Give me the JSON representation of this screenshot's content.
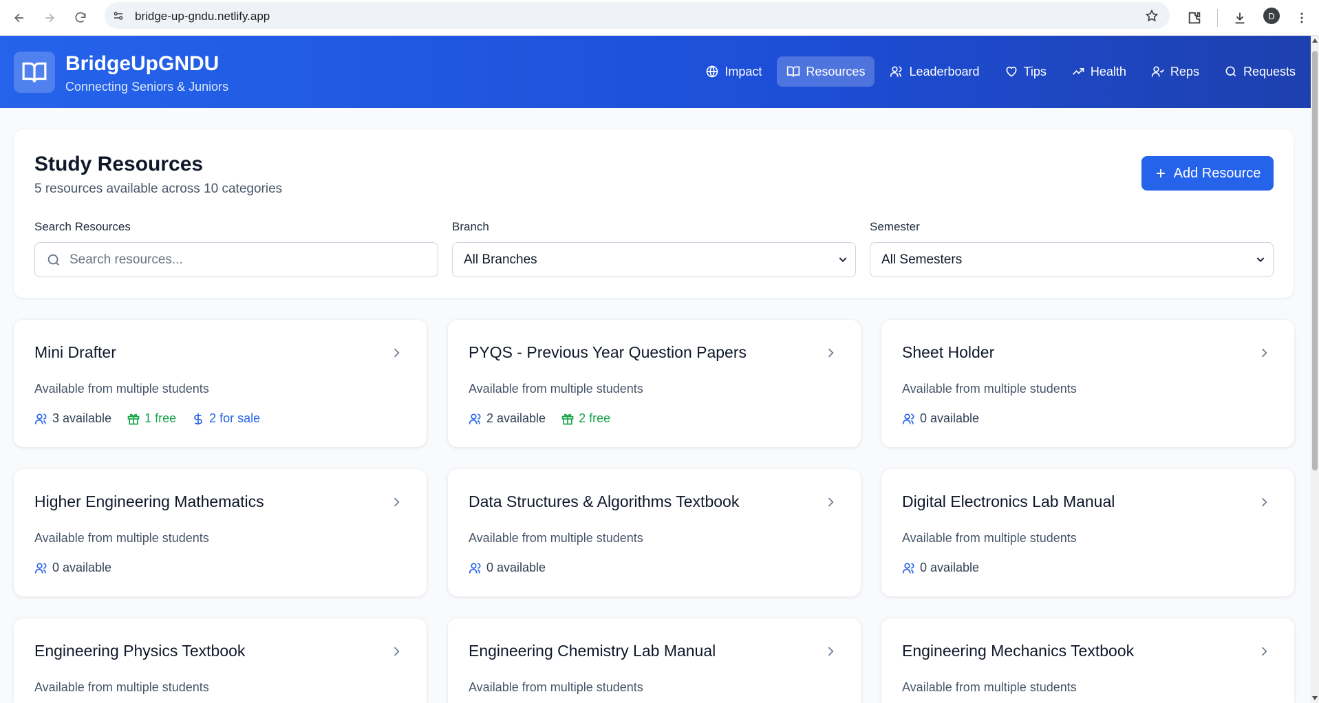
{
  "browser": {
    "url": "bridge-up-gndu.netlify.app",
    "profile_initial": "D"
  },
  "header": {
    "brand": "BridgeUpGNDU",
    "tagline": "Connecting Seniors & Juniors",
    "nav": [
      {
        "label": "Impact",
        "icon": "globe-icon"
      },
      {
        "label": "Resources",
        "icon": "book-open-icon",
        "active": true
      },
      {
        "label": "Leaderboard",
        "icon": "users-icon"
      },
      {
        "label": "Tips",
        "icon": "heart-icon"
      },
      {
        "label": "Health",
        "icon": "trending-up-icon"
      },
      {
        "label": "Reps",
        "icon": "user-check-icon"
      },
      {
        "label": "Requests",
        "icon": "search-icon"
      }
    ]
  },
  "panel": {
    "title": "Study Resources",
    "subtitle": "5 resources available across 10 categories",
    "add_label": "Add Resource",
    "search_label": "Search Resources",
    "search_placeholder": "Search resources...",
    "branch_label": "Branch",
    "branch_value": "All Branches",
    "semester_label": "Semester",
    "semester_value": "All Semesters"
  },
  "cards": [
    {
      "title": "Mini Drafter",
      "desc": "Available from multiple students",
      "available": "3 available",
      "free": "1 free",
      "sale": "2 for sale"
    },
    {
      "title": "PYQS - Previous Year Question Papers",
      "desc": "Available from multiple students",
      "available": "2 available",
      "free": "2 free"
    },
    {
      "title": "Sheet Holder",
      "desc": "Available from multiple students",
      "available": "0 available"
    },
    {
      "title": "Higher Engineering Mathematics",
      "desc": "Available from multiple students",
      "available": "0 available"
    },
    {
      "title": "Data Structures & Algorithms Textbook",
      "desc": "Available from multiple students",
      "available": "0 available"
    },
    {
      "title": "Digital Electronics Lab Manual",
      "desc": "Available from multiple students",
      "available": "0 available"
    },
    {
      "title": "Engineering Physics Textbook",
      "desc": "Available from multiple students"
    },
    {
      "title": "Engineering Chemistry Lab Manual",
      "desc": "Available from multiple students"
    },
    {
      "title": "Engineering Mechanics Textbook",
      "desc": "Available from multiple students"
    }
  ],
  "colors": {
    "primary": "#2563eb",
    "free": "#16a34a",
    "header_end": "#1e40af"
  }
}
